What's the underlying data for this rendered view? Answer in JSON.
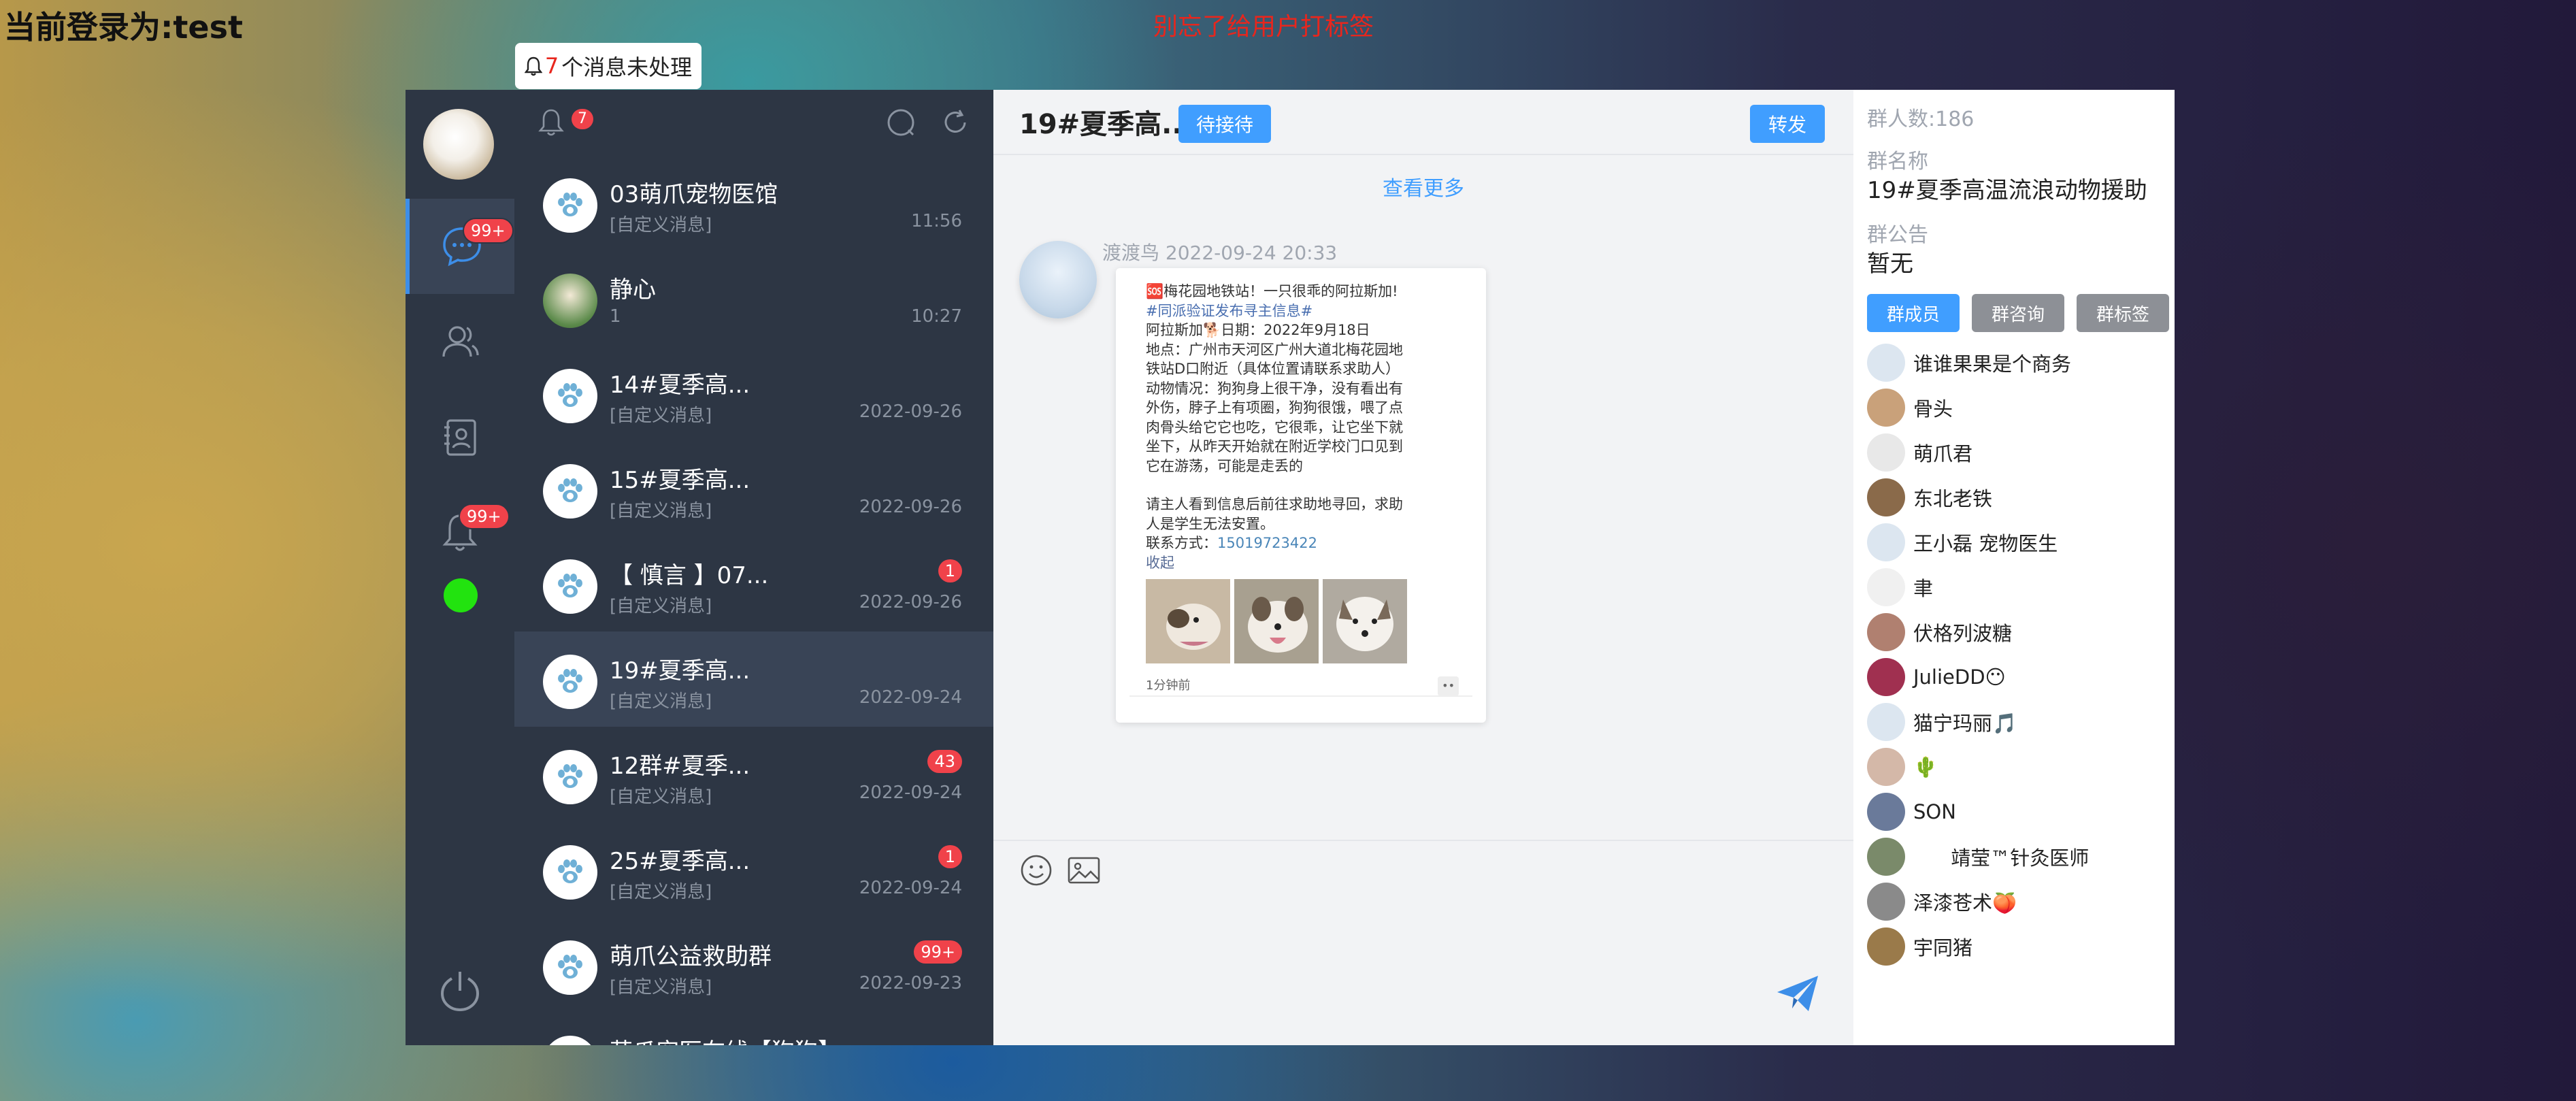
{
  "header": {
    "login_text": "当前登录为:test",
    "warning_text": "别忘了给用户打标签",
    "notice_count": "7",
    "notice_text": " 个消息未处理"
  },
  "nav": {
    "chat_badge": "99+",
    "alert_badge": "99+",
    "online_color": "#22e30f",
    "accent": "#409eff"
  },
  "list": {
    "bell_badge": "7",
    "conversations": [
      {
        "title": "03萌爪宠物医馆",
        "sub": "[自定义消息]",
        "time": "11:56",
        "badge": ""
      },
      {
        "title": "静心",
        "sub": "1",
        "time": "10:27",
        "badge": ""
      },
      {
        "title": "14#夏季高...",
        "sub": "[自定义消息]",
        "time": "2022-09-26",
        "badge": ""
      },
      {
        "title": "15#夏季高...",
        "sub": "[自定义消息]",
        "time": "2022-09-26",
        "badge": ""
      },
      {
        "title": "【 慎言 】07...",
        "sub": "[自定义消息]",
        "time": "2022-09-26",
        "badge": "1"
      },
      {
        "title": "19#夏季高...",
        "sub": "[自定义消息]",
        "time": "2022-09-24",
        "badge": ""
      },
      {
        "title": "12群#夏季...",
        "sub": "[自定义消息]",
        "time": "2022-09-24",
        "badge": "43"
      },
      {
        "title": "25#夏季高...",
        "sub": "[自定义消息]",
        "time": "2022-09-24",
        "badge": "1"
      },
      {
        "title": "萌爪公益救助群",
        "sub": "[自定义消息]",
        "time": "2022-09-23",
        "badge": "99+"
      },
      {
        "title": "萌爪宠医在线【狗狗】",
        "sub": "",
        "time": "",
        "badge": ""
      }
    ]
  },
  "chat": {
    "title": "19#夏季高...",
    "pending_label": "待接待",
    "forward_label": "转发",
    "more_label": "查看更多",
    "message": {
      "sender": "渡渡鸟",
      "time": "2022-09-24 20:33",
      "line1": "🆘梅花园地铁站！一只很乖的阿拉斯加!",
      "tag": "#同派验证发布寻主信息#",
      "line3": "阿拉斯加🐕日期：2022年9月18日",
      "line4": "地点：广州市天河区广州大道北梅花园地",
      "line5": "铁站D口附近（具体位置请联系求助人）",
      "line6": "动物情况：狗狗身上很干净，没有看出有",
      "line7": "外伤，脖子上有项圈，狗狗很饿，喂了点",
      "line8": "肉骨头给它它也吃，它很乖，让它坐下就",
      "line9": "坐下，从昨天开始就在附近学校门口见到",
      "line10": "它在游荡，可能是走丢的",
      "line11": "请主人看到信息后前往求助地寻回，求助",
      "line12": "人是学生无法安置。",
      "contact_label": "联系方式：",
      "contact_phone": "15019723422",
      "collapse": "收起",
      "footer_time": "1分钟前",
      "footer_dots": "••"
    }
  },
  "info": {
    "count_label": "群人数:186",
    "name_label": "群名称",
    "name_value": "19#夏季高温流浪动物援助",
    "notice_label": "群公告",
    "notice_value": "暂无",
    "btn_members": "群成员",
    "btn_consult": "群咨询",
    "btn_tags": "群标签",
    "members": [
      {
        "name": "谁谁果果是个商务",
        "color": "#dce6f0"
      },
      {
        "name": "骨头",
        "color": "#c9a17a"
      },
      {
        "name": "萌爪君",
        "color": "#e8e8e8"
      },
      {
        "name": "东北老铁",
        "color": "#8a6a4a"
      },
      {
        "name": "王小磊 宠物医生",
        "color": "#dce6f0"
      },
      {
        "name": "聿",
        "color": "#f0f0f0"
      },
      {
        "name": "伏格列波糖",
        "color": "#b08070"
      },
      {
        "name": "JulieDD😶",
        "color": "#a03050"
      },
      {
        "name": "猫宁玛丽🎵",
        "color": "#dce6f0"
      },
      {
        "name": "🌵",
        "color": "#d4b8a8"
      },
      {
        "name": "SON",
        "color": "#6a7a9a"
      },
      {
        "name": "      靖莹™针灸医师",
        "color": "#7a8a6a"
      },
      {
        "name": "泽漆苍术🍑",
        "color": "#8a8a8a"
      },
      {
        "name": "宇同猪",
        "color": "#9a7a4a"
      }
    ]
  }
}
